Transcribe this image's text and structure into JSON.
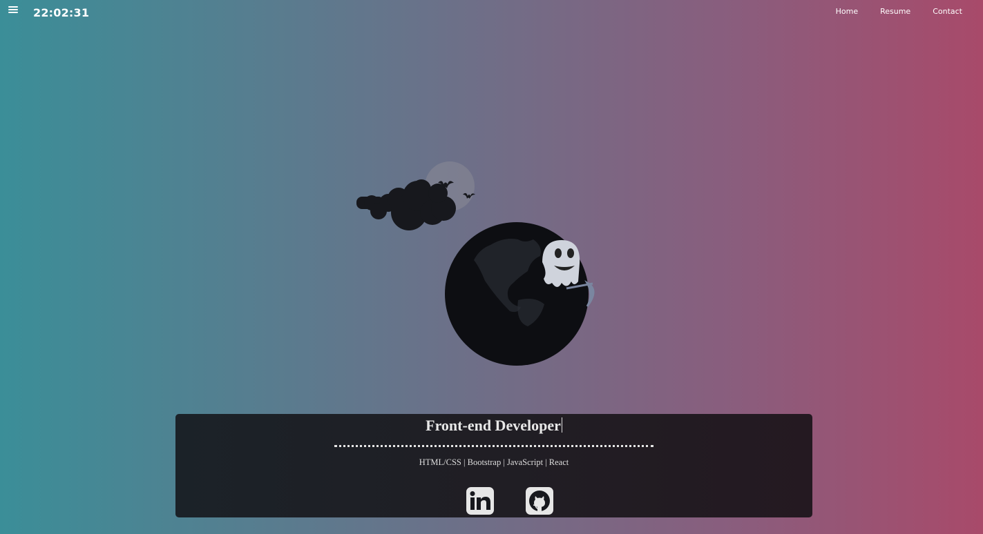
{
  "header": {
    "clock": "22:02:31",
    "nav": [
      "Home",
      "Resume",
      "Contact"
    ]
  },
  "hero": {
    "illustration": "halloween-globe-ghost-icon"
  },
  "panel": {
    "role": "Front-end Developer",
    "skills": "HTML/CSS | Bootstrap | JavaScript | React",
    "socials": [
      "linkedin-icon",
      "github-icon"
    ]
  },
  "colors": {
    "gradient_left": "#3b8e98",
    "gradient_right": "#a84a6a",
    "panel_bg": "#1d1f25"
  }
}
